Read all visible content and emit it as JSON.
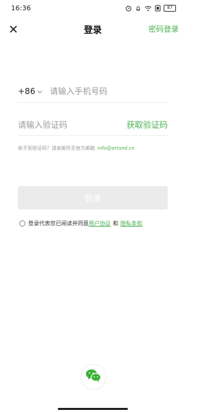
{
  "status": {
    "time": "16:36",
    "battery": "87",
    "icons": [
      "alarm-icon",
      "bell-icon",
      "wifi-icon",
      "screen-icon"
    ]
  },
  "header": {
    "close_icon": "close-icon",
    "title": "登录",
    "password_login": "密码登录"
  },
  "form": {
    "country_code": "+86",
    "phone_placeholder": "请输入手机号码",
    "code_placeholder": "请输入验证码",
    "get_code": "获取验证码",
    "help_text": "收不到验证码？请发邮件至官方邮箱",
    "help_email": "info@artand.cn",
    "login_button": "登录"
  },
  "agreement": {
    "prefix": "登录代表您已阅读并同意",
    "user_agreement": "用户协议",
    "and": "和",
    "privacy_policy": "隐私条款"
  },
  "social": {
    "wechat_icon": "wechat-icon"
  },
  "colors": {
    "accent": "#4cb050",
    "disabled_button": "#ebebeb",
    "hint": "#9a9a9a",
    "divider": "#eeeeee"
  }
}
